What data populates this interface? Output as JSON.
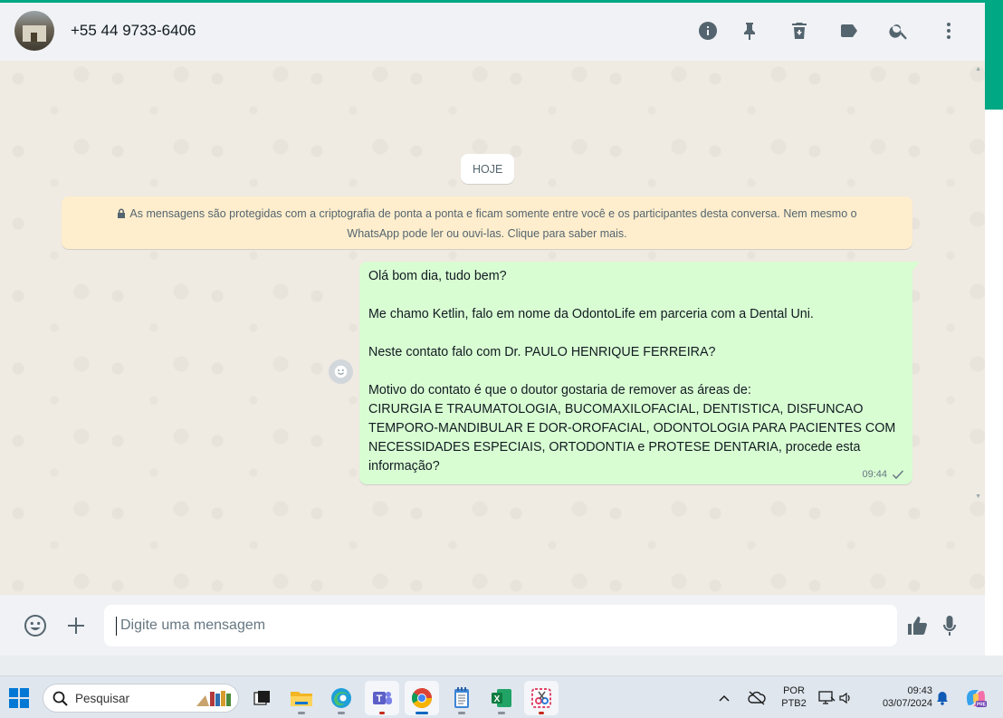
{
  "header": {
    "contact_name": "+55 44 9733-6406",
    "icons": [
      "info-icon",
      "pin-icon",
      "delete-icon",
      "label-icon",
      "search-icon",
      "menu-icon"
    ]
  },
  "chat": {
    "date_chip": "HOJE",
    "encryption_notice": {
      "line1": "As mensagens são protegidas com a criptografia de ponta a ponta e ficam somente entre você e os participantes desta conversa. Nem mesmo o",
      "line2": "WhatsApp pode ler ou ouvi-las. Clique para saber mais."
    },
    "message": {
      "lines": [
        "Olá bom dia, tudo bem?",
        "",
        "Me chamo Ketlin, falo em nome da OdontoLife em parceria com a Dental Uni.",
        "",
        "Neste contato falo com Dr. PAULO HENRIQUE FERREIRA?",
        "",
        "Motivo do contato é que o doutor gostaria de remover as áreas de:",
        "CIRURGIA E TRAUMATOLOGIA, BUCOMAXILOFACIAL, DENTISTICA, DISFUNCAO",
        "TEMPORO-MANDIBULAR E DOR-OROFACIAL, ODONTOLOGIA PARA PACIENTES COM",
        "NECESSIDADES ESPECIAIS, ORTODONTIA e PROTESE DENTARIA, procede esta",
        "informação?"
      ],
      "time": "09:44",
      "status": "sent-single-check"
    }
  },
  "composer": {
    "placeholder": "Digite uma mensagem",
    "value": ""
  },
  "taskbar": {
    "search_label": "Pesquisar",
    "apps": [
      "windows-start",
      "task-view",
      "file-explorer",
      "edge",
      "teams",
      "chrome",
      "notepad",
      "excel",
      "snipping-tool"
    ],
    "tray": {
      "lang_line1": "POR",
      "lang_line2": "PTB2",
      "time": "09:43",
      "date": "03/07/2024"
    }
  },
  "colors": {
    "accent": "#00a884",
    "bubble_out": "#d9fdd3",
    "encryption_bg": "#ffeecd",
    "chat_bg": "#efeae2"
  }
}
